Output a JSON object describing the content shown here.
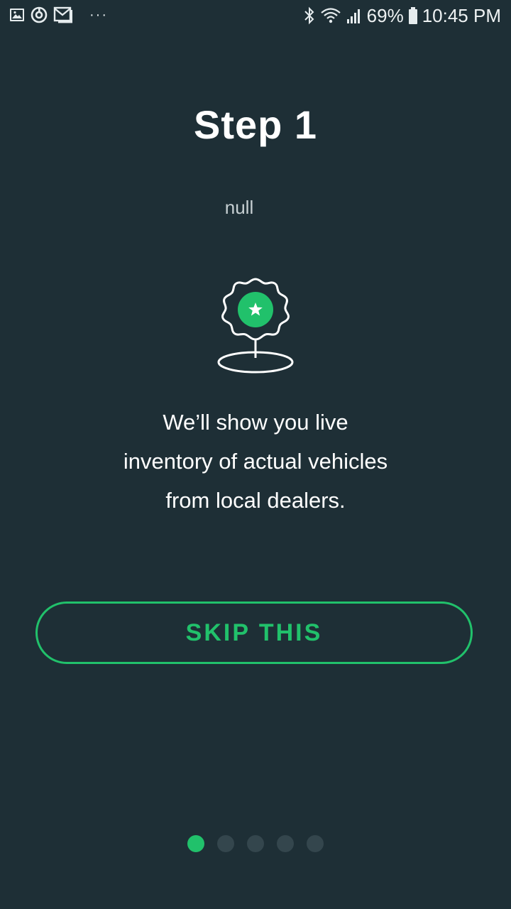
{
  "status_bar": {
    "left_icons": [
      "gallery-icon",
      "sync-icon",
      "gmail-icon"
    ],
    "overflow_dots": "···",
    "right_icons": [
      "bluetooth-icon",
      "wifi-icon",
      "signal-icon"
    ],
    "battery_percent": "69%",
    "time": "10:45 PM"
  },
  "onboarding": {
    "title": "Step 1",
    "subtitle": "null",
    "illustration_icon": "location-badge-star-icon",
    "description_lines": [
      "We’ll show you live",
      "inventory of actual vehicles",
      "from local dealers."
    ],
    "skip_label": "SKIP THIS"
  },
  "pager": {
    "total_pages": 5,
    "current_page": 1
  },
  "colors": {
    "background": "#1e2f36",
    "accent": "#21c16b",
    "inactive_dot": "#34464d"
  }
}
